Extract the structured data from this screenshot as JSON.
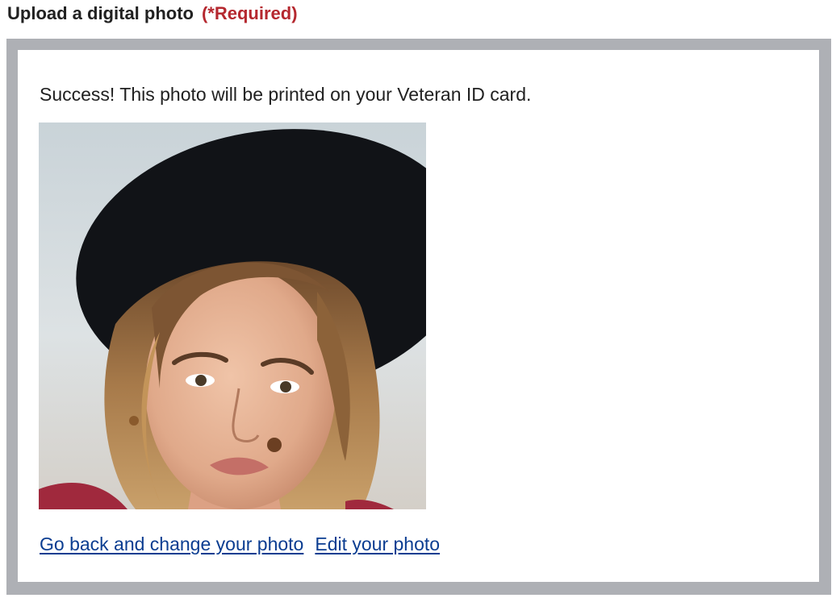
{
  "field": {
    "label": "Upload a digital photo",
    "required": "(*Required)"
  },
  "upload": {
    "success_message": "Success! This photo will be printed on your Veteran ID card.",
    "photo_alt": "Uploaded photo of a woman wearing a black hat"
  },
  "links": {
    "go_back": "Go back and change your photo",
    "edit": "Edit your photo"
  },
  "colors": {
    "required": "#b5282f",
    "link": "#0b3d91",
    "border": "#aeb0b5"
  }
}
